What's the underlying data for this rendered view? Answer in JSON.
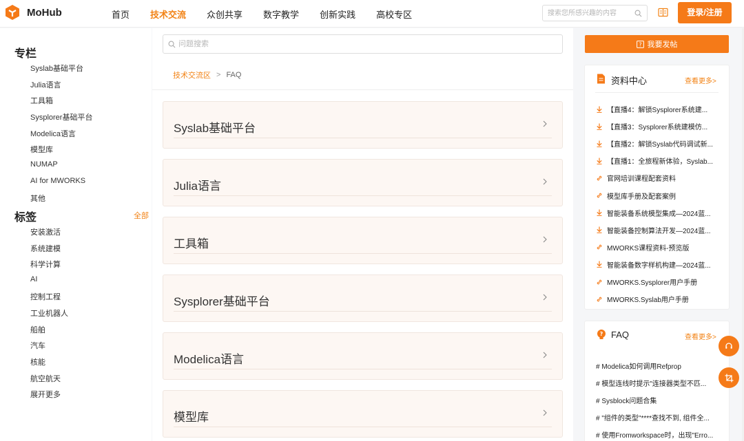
{
  "colors": {
    "accent": "#f57a18",
    "link": "#f28316",
    "card_bg": "#fdf7f3"
  },
  "header": {
    "logo_text": "MoHub",
    "nav": [
      "首页",
      "技术交流",
      "众创共享",
      "数字教学",
      "创新实践",
      "高校专区"
    ],
    "active_nav": "技术交流",
    "search_placeholder": "搜索您所感兴趣的内容",
    "login_label": "登录/注册"
  },
  "sidebar": {
    "columns_heading": "专栏",
    "columns": [
      "Syslab基础平台",
      "Julia语言",
      "工具箱",
      "Sysplorer基础平台",
      "Modelica语言",
      "模型库",
      "NUMAP",
      "AI for MWORKS",
      "其他"
    ],
    "tags_heading": "标签",
    "tags_all": "全部",
    "tags": [
      "安装激活",
      "系统建模",
      "科学计算",
      "AI",
      "控制工程",
      "工业机器人",
      "船舶",
      "汽车",
      "核能",
      "航空航天",
      "展开更多"
    ]
  },
  "main": {
    "search_placeholder": "问题搜索",
    "breadcrumb": {
      "parent": "技术交流区",
      "separator": ">",
      "current": "FAQ"
    },
    "categories": [
      "Syslab基础平台",
      "Julia语言",
      "工具箱",
      "Sysplorer基础平台",
      "Modelica语言",
      "模型库"
    ]
  },
  "right": {
    "post_label": "我要发帖",
    "resources": {
      "title": "资料中心",
      "more": "查看更多>",
      "items": [
        {
          "icon": "download-icon",
          "text": "【直播4：解锁Sysplorer系统建..."
        },
        {
          "icon": "download-icon",
          "text": "【直播3：Sysplorer系统建模仿..."
        },
        {
          "icon": "download-icon",
          "text": "【直播2：解锁Syslab代码调试新..."
        },
        {
          "icon": "download-icon",
          "text": "【直播1：全旅程新体验，Syslab..."
        },
        {
          "icon": "link-icon",
          "text": "官网培训课程配套资料"
        },
        {
          "icon": "link-icon",
          "text": "模型库手册及配套案例"
        },
        {
          "icon": "download-icon",
          "text": "智能装备系统模型集成—2024蓝..."
        },
        {
          "icon": "download-icon",
          "text": "智能装备控制算法开发—2024蓝..."
        },
        {
          "icon": "link-icon",
          "text": "MWORKS课程资料-预览版"
        },
        {
          "icon": "download-icon",
          "text": "智能装备数字样机构建—2024蓝..."
        },
        {
          "icon": "link-icon",
          "text": "MWORKS.Sysplorer用户手册"
        },
        {
          "icon": "link-icon",
          "text": "MWORKS.Syslab用户手册"
        }
      ]
    },
    "faq": {
      "title": "FAQ",
      "more": "查看更多>",
      "items": [
        "# Modelica如何调用Refprop",
        "# 模型连线时提示\"连接器类型不匹...",
        "# Sysblock问题合集",
        "# \"组件的类型\"****查找不到, 组件全...",
        "# 使用Fromworkspace时，出现\"Erro..."
      ]
    }
  }
}
